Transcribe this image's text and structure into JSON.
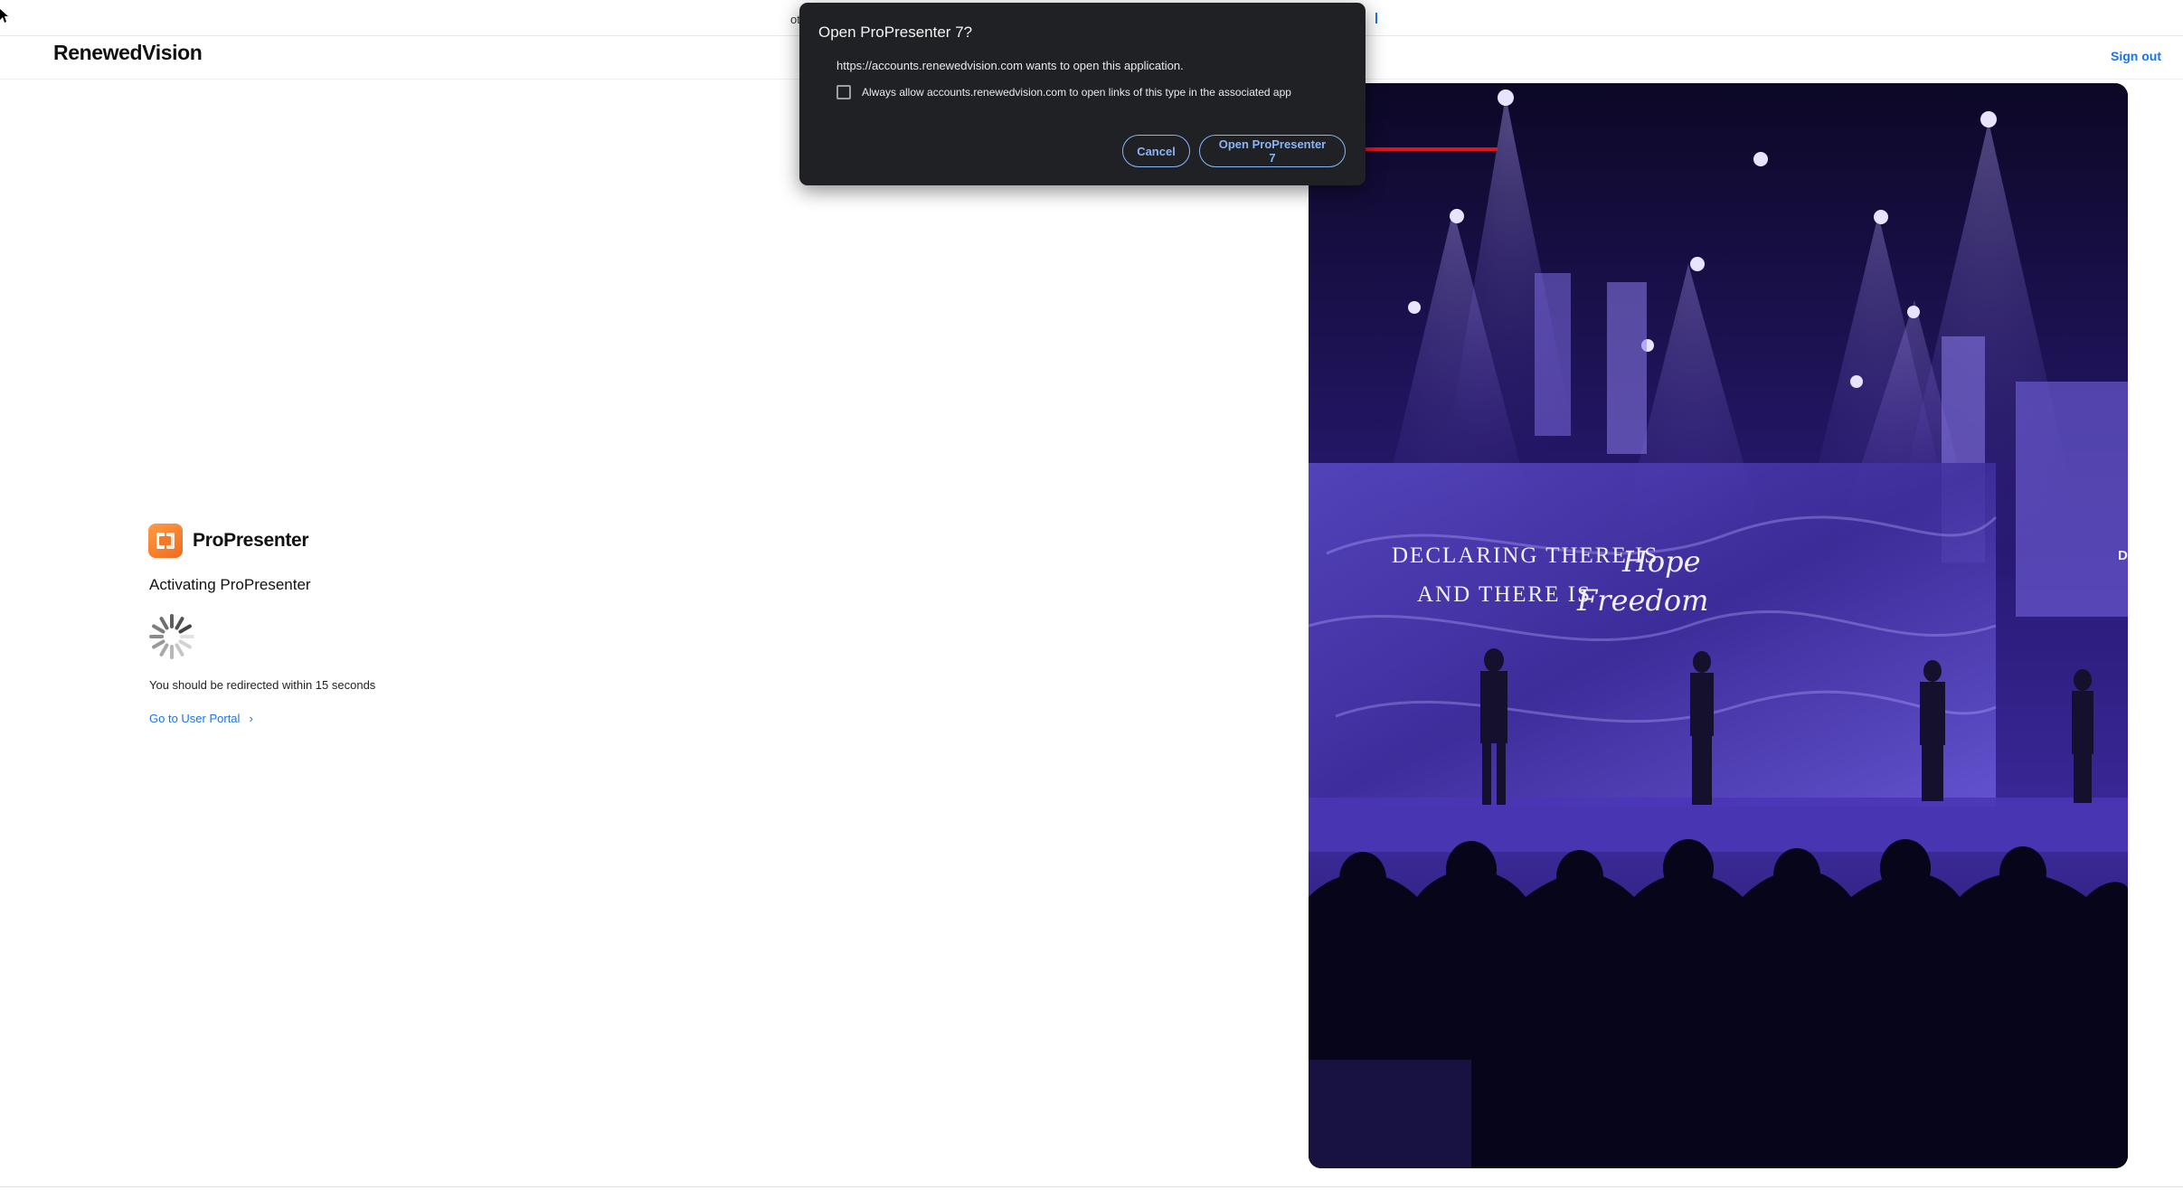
{
  "browser": {
    "tab_fragment": "ot"
  },
  "header": {
    "brand": "RenewedVision",
    "sign_out": "Sign out"
  },
  "activation": {
    "product_name": "ProPresenter",
    "status": "Activating ProPresenter",
    "redirect_note": "You should be redirected within 15 seconds",
    "portal_link": "Go to User Portal",
    "portal_chevron": "›"
  },
  "hero": {
    "stage_text_line1": "DECLARING THERE IS",
    "stage_text_word1": "Hope",
    "stage_text_line2": "AND THERE IS",
    "stage_text_word2": "Freedom",
    "edge_letter": "D"
  },
  "dialog": {
    "title": "Open ProPresenter 7?",
    "message": "https://accounts.renewedvision.com wants to open this application.",
    "checkbox_label": "Always allow accounts.renewedvision.com to open links of this type in the associated app",
    "checkbox_checked": false,
    "cancel_label": "Cancel",
    "open_label": "Open ProPresenter 7"
  },
  "colors": {
    "link_blue": "#1a73e8",
    "dialog_bg": "#202124",
    "dialog_button": "#8ab4f8",
    "brand_orange": "#ef6b1f",
    "annotation_red": "#e0151b",
    "stage_purple": "#5b3cc4"
  }
}
